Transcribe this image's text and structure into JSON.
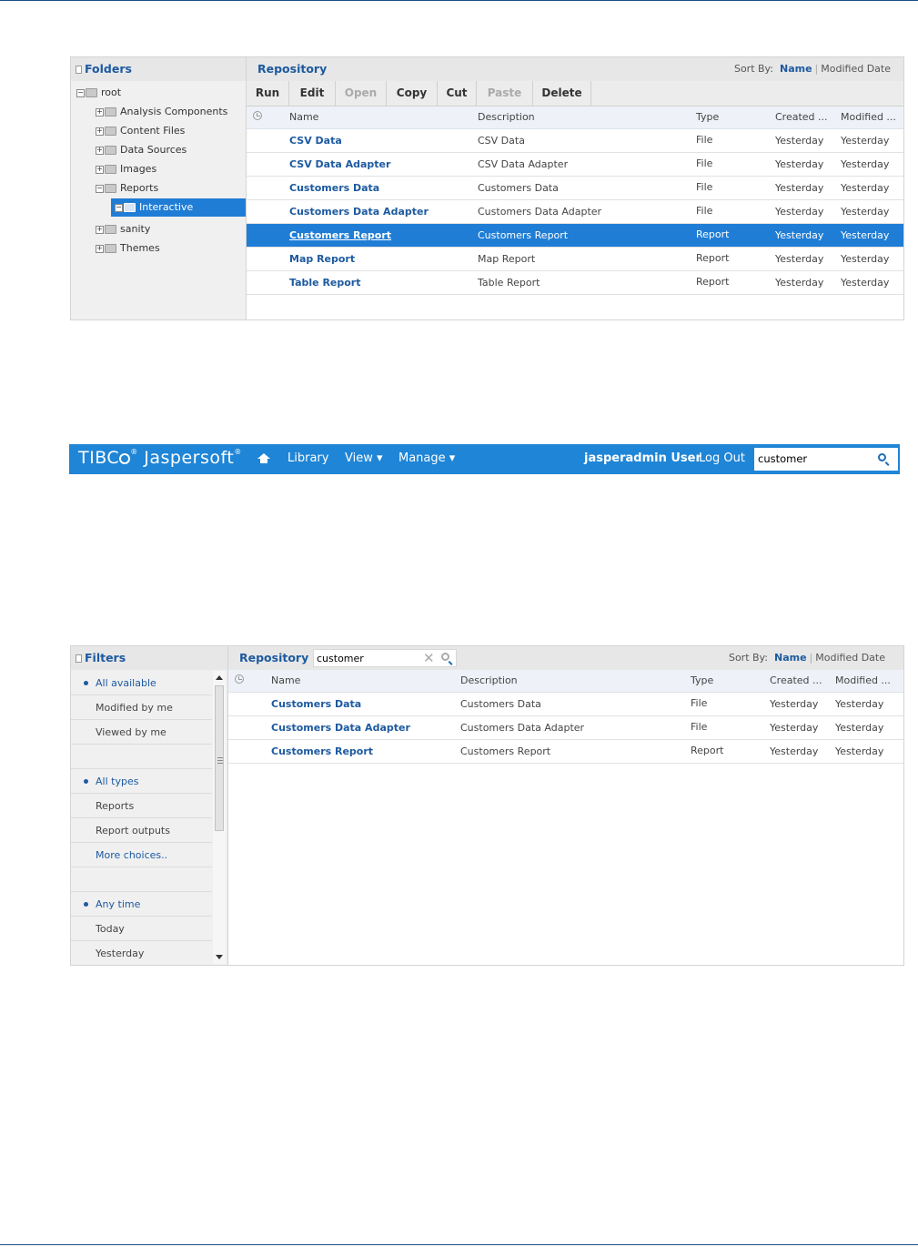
{
  "panel1": {
    "folders_title": "Folders",
    "tree": [
      {
        "label": "root",
        "expander": "−"
      },
      {
        "label": "Analysis Components",
        "expander": "+"
      },
      {
        "label": "Content Files",
        "expander": "+"
      },
      {
        "label": "Data Sources",
        "expander": "+"
      },
      {
        "label": "Images",
        "expander": "+"
      },
      {
        "label": "Reports",
        "expander": "−"
      },
      {
        "label": "Interactive",
        "expander": "−",
        "selected": true
      },
      {
        "label": "sanity",
        "expander": "+"
      },
      {
        "label": "Themes",
        "expander": "+"
      }
    ],
    "repository_title": "Repository",
    "sort_by_label": "Sort By:",
    "sort_name": "Name",
    "sort_modified": "Modified Date",
    "toolbar": {
      "run": "Run",
      "edit": "Edit",
      "open": "Open",
      "copy": "Copy",
      "cut": "Cut",
      "paste": "Paste",
      "delete": "Delete"
    },
    "columns": {
      "name": "Name",
      "description": "Description",
      "type": "Type",
      "created": "Created ...",
      "modified": "Modified ..."
    },
    "rows": [
      {
        "name": "CSV Data",
        "description": "CSV Data",
        "type": "File",
        "created": "Yesterday",
        "modified": "Yesterday"
      },
      {
        "name": "CSV Data Adapter",
        "description": "CSV Data Adapter",
        "type": "File",
        "created": "Yesterday",
        "modified": "Yesterday"
      },
      {
        "name": "Customers Data",
        "description": "Customers Data",
        "type": "File",
        "created": "Yesterday",
        "modified": "Yesterday"
      },
      {
        "name": "Customers Data Adapter",
        "description": "Customers Data Adapter",
        "type": "File",
        "created": "Yesterday",
        "modified": "Yesterday"
      },
      {
        "name": "Customers Report",
        "description": "Customers Report",
        "type": "Report",
        "created": "Yesterday",
        "modified": "Yesterday",
        "selected": true
      },
      {
        "name": "Map Report",
        "description": "Map Report",
        "type": "Report",
        "created": "Yesterday",
        "modified": "Yesterday"
      },
      {
        "name": "Table Report",
        "description": "Table Report",
        "type": "Report",
        "created": "Yesterday",
        "modified": "Yesterday"
      }
    ]
  },
  "banner": {
    "logo_tibco": "TIBC",
    "logo_rest": "Jaspersoft",
    "reg_mark": "®",
    "nav_library": "Library",
    "nav_view": "View ▾",
    "nav_manage": "Manage ▾",
    "user": "jasperadmin User",
    "logout": "Log Out",
    "search_value": "customer",
    "accent": "#1f85d6"
  },
  "panel3": {
    "filters_title": "Filters",
    "repository_title": "Repository",
    "search_value": "customer",
    "sort_by_label": "Sort By:",
    "sort_name": "Name",
    "sort_modified": "Modified Date",
    "filters": [
      {
        "label": "All available",
        "state": "on"
      },
      {
        "label": "Modified by me",
        "state": ""
      },
      {
        "label": "Viewed by me",
        "state": ""
      },
      {
        "label": "",
        "state": ""
      },
      {
        "label": "All types",
        "state": "on"
      },
      {
        "label": "Reports",
        "state": ""
      },
      {
        "label": "Report outputs",
        "state": ""
      },
      {
        "label": "More choices..",
        "state": "link"
      },
      {
        "label": "",
        "state": ""
      },
      {
        "label": "Any time",
        "state": "on"
      },
      {
        "label": "Today",
        "state": ""
      },
      {
        "label": "Yesterday",
        "state": ""
      }
    ],
    "columns": {
      "name": "Name",
      "description": "Description",
      "type": "Type",
      "created": "Created ...",
      "modified": "Modified ..."
    },
    "rows": [
      {
        "name": "Customers Data",
        "description": "Customers Data",
        "type": "File",
        "created": "Yesterday",
        "modified": "Yesterday"
      },
      {
        "name": "Customers Data Adapter",
        "description": "Customers Data Adapter",
        "type": "File",
        "created": "Yesterday",
        "modified": "Yesterday"
      },
      {
        "name": "Customers Report",
        "description": "Customers Report",
        "type": "Report",
        "created": "Yesterday",
        "modified": "Yesterday"
      }
    ]
  }
}
